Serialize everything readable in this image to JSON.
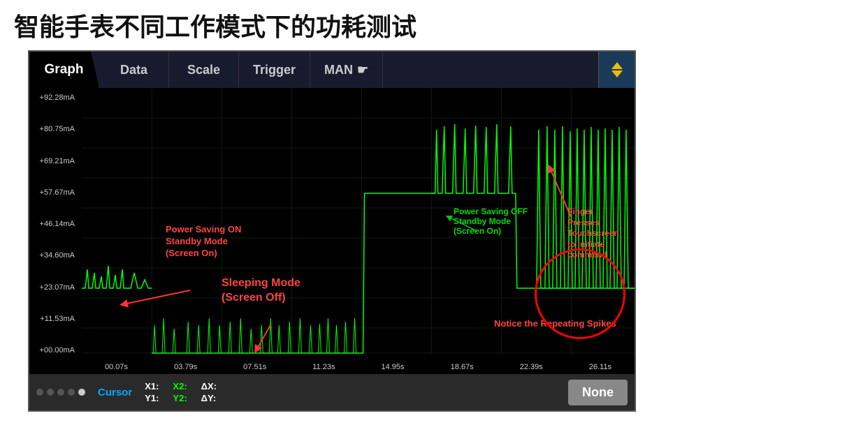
{
  "title": "智能手表不同工作模式下的功耗测试",
  "tabs": [
    {
      "label": "Graph",
      "active": true
    },
    {
      "label": "Data",
      "active": false
    },
    {
      "label": "Scale",
      "active": false
    },
    {
      "label": "Trigger",
      "active": false
    },
    {
      "label": "MAN",
      "active": false
    }
  ],
  "y_axis": [
    "+92.28mA",
    "+80.75mA",
    "+69.21mA",
    "+57.67mA",
    "+46.14mA",
    "+34.60mA",
    "+23.07mA",
    "+11.53mA",
    "+00.00mA"
  ],
  "x_axis": [
    "00.07s",
    "03.79s",
    "07.51s",
    "11.23s",
    "14.95s",
    "18.67s",
    "22.39s",
    "26.11s"
  ],
  "annotations": {
    "power_saving_on": "Power Saving ON\nStandby Mode\n(Screen On)",
    "sleeping_mode": "Sleeping Mode\n(Screen Off)",
    "power_saving_off": "Power Saving OFF\nStandby Mode\n(Screen On)",
    "finger_presses": "Finger\nPresses\nTouchscreen\nto initiate\ncommend",
    "repeating_spikes": "Notice the Repeating Spikes"
  },
  "bottom": {
    "cursor_label": "Cursor",
    "x1_label": "X1:",
    "y1_label": "Y1:",
    "x2_label": "X2:",
    "y2_label": "Y2:",
    "dx_label": "ΔX:",
    "dy_label": "ΔY:",
    "none_button": "None",
    "dots": [
      false,
      false,
      false,
      false,
      true
    ]
  },
  "colors": {
    "graph_line": "#00ff00",
    "annotation_red": "#ff3333",
    "tab_active_bg": "#000000",
    "tab_bar_bg": "#111133",
    "bottom_bar_bg": "#2a2a2a"
  }
}
